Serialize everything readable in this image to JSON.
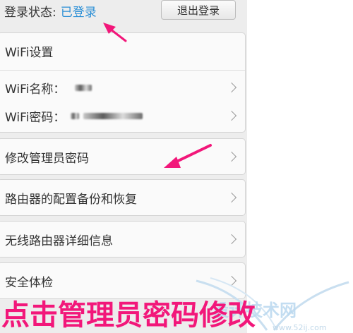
{
  "status": {
    "label": "登录状态:",
    "value": "已登录",
    "logout_label": "退出登录"
  },
  "wifi": {
    "header": "WiFi设置",
    "name_label": "WiFi名称：",
    "password_label": "WiFi密码："
  },
  "menu": {
    "change_admin_password": "修改管理员密码",
    "backup_restore": "路由器的配置备份和恢复",
    "router_details": "无线路由器详细信息",
    "security_check": "安全体检"
  },
  "caption": "点击管理员密码修改",
  "watermark": {
    "text": "设计技术网",
    "url": "www.52ij.com"
  },
  "colors": {
    "status_value": "#2b8fd6",
    "annotation": "#f2177a",
    "caption": "#f2177a"
  }
}
